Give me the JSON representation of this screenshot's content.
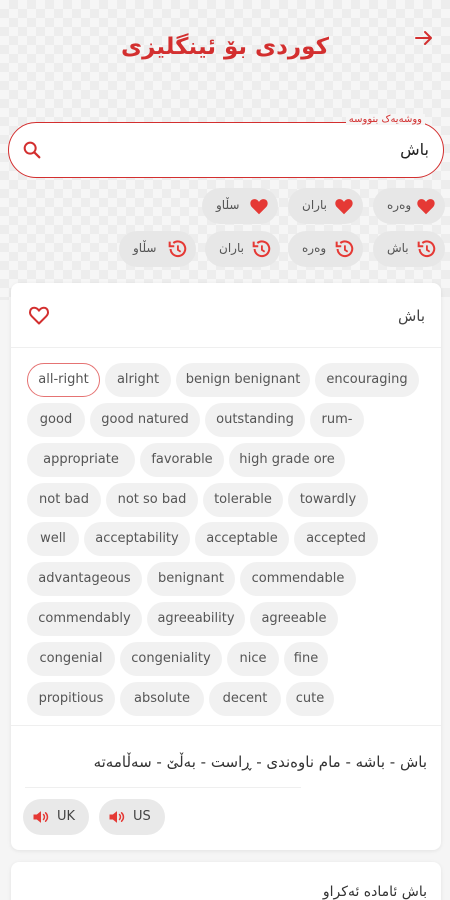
{
  "header": {
    "title": "کوردی بۆ ئینگلیزی"
  },
  "search": {
    "label": "ووشەیەک بنووسە",
    "value": "باش"
  },
  "favorites": [
    "وەرە",
    "باران",
    "سڵاو"
  ],
  "history": [
    "باش",
    "وەرە",
    "باران",
    "سڵاو"
  ],
  "card": {
    "word": "باش",
    "synonyms": [
      "all-right",
      "alright",
      "benign benignant",
      "encouraging",
      "good",
      "good natured",
      "outstanding",
      "rum-",
      "appropriate",
      "favorable",
      "high grade ore",
      "not bad",
      "not so bad",
      "tolerable",
      "towardly",
      "well",
      "acceptability",
      "acceptable",
      "accepted",
      "advantageous",
      "benignant",
      "commendable",
      "commendably",
      "agreeability",
      "agreeable",
      "congenial",
      "congeniality",
      "nice",
      "fine",
      "propitious",
      "absolute",
      "decent",
      "cute"
    ],
    "meaning": "باش - باشە - مام ناوەندی - ڕاست - بەڵێ - سەڵامەتە",
    "speak": {
      "uk": "UK",
      "us": "US"
    }
  },
  "second_card": {
    "text": "باش ئامادە ئەکراو"
  },
  "colors": {
    "accent": "#d32f2f"
  }
}
